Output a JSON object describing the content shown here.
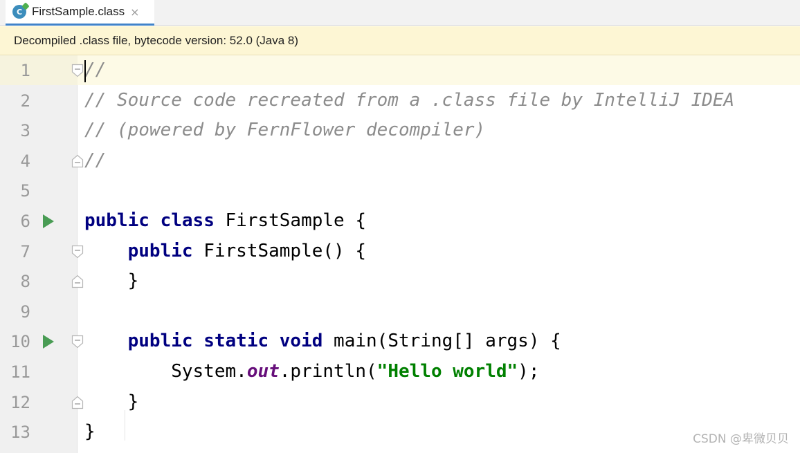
{
  "tab": {
    "title": "FirstSample.class",
    "icon": "class-file-icon",
    "icon_letter": "C",
    "close": "×"
  },
  "banner": {
    "text": "Decompiled .class file, bytecode version: 52.0 (Java 8)"
  },
  "editor": {
    "lines": [
      {
        "num": "1",
        "fold": "start",
        "run": false,
        "tokens": [
          {
            "t": "//",
            "c": "comment"
          }
        ]
      },
      {
        "num": "2",
        "fold": "",
        "run": false,
        "tokens": [
          {
            "t": "// Source code recreated from a .class file by IntelliJ IDEA",
            "c": "comment"
          }
        ]
      },
      {
        "num": "3",
        "fold": "",
        "run": false,
        "tokens": [
          {
            "t": "// (powered by FernFlower decompiler)",
            "c": "comment"
          }
        ]
      },
      {
        "num": "4",
        "fold": "end",
        "run": false,
        "tokens": [
          {
            "t": "//",
            "c": "comment"
          }
        ]
      },
      {
        "num": "5",
        "fold": "",
        "run": false,
        "tokens": []
      },
      {
        "num": "6",
        "fold": "",
        "run": true,
        "tokens": [
          {
            "t": "public",
            "c": "kw"
          },
          {
            "t": " "
          },
          {
            "t": "class",
            "c": "kw"
          },
          {
            "t": " FirstSample {"
          }
        ]
      },
      {
        "num": "7",
        "fold": "start",
        "run": false,
        "tokens": [
          {
            "t": "    "
          },
          {
            "t": "public",
            "c": "kw"
          },
          {
            "t": " FirstSample() {"
          }
        ]
      },
      {
        "num": "8",
        "fold": "end",
        "run": false,
        "tokens": [
          {
            "t": "    }"
          }
        ]
      },
      {
        "num": "9",
        "fold": "",
        "run": false,
        "tokens": []
      },
      {
        "num": "10",
        "fold": "start",
        "run": true,
        "tokens": [
          {
            "t": "    "
          },
          {
            "t": "public",
            "c": "kw"
          },
          {
            "t": " "
          },
          {
            "t": "static",
            "c": "kw"
          },
          {
            "t": " "
          },
          {
            "t": "void",
            "c": "kw"
          },
          {
            "t": " main(String[] args) {"
          }
        ]
      },
      {
        "num": "11",
        "fold": "",
        "run": false,
        "tokens": [
          {
            "t": "        System."
          },
          {
            "t": "out",
            "c": "field"
          },
          {
            "t": ".println("
          },
          {
            "t": "\"Hello world\"",
            "c": "str"
          },
          {
            "t": ");"
          }
        ]
      },
      {
        "num": "12",
        "fold": "end",
        "run": false,
        "tokens": [
          {
            "t": "    }"
          }
        ]
      },
      {
        "num": "13",
        "fold": "",
        "run": false,
        "tokens": [
          {
            "t": "}"
          }
        ]
      }
    ]
  },
  "watermark": "CSDN @卑微贝贝",
  "colors": {
    "keyword": "#000080",
    "comment": "#8c8c8c",
    "string": "#008000",
    "field": "#660e7a",
    "run": "#499c54",
    "banner_bg": "#fdf6d4"
  }
}
